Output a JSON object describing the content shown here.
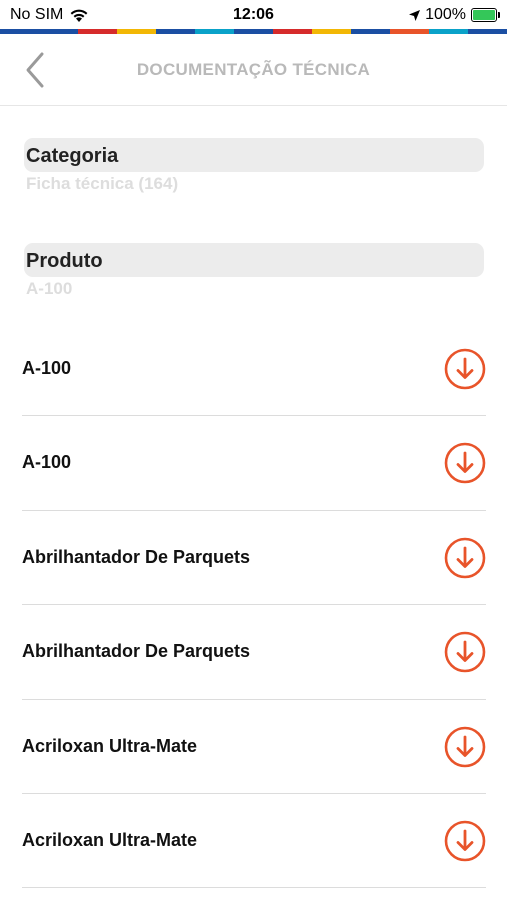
{
  "status_bar": {
    "carrier": "No SIM",
    "time": "12:06",
    "battery": "100%"
  },
  "colors": {
    "accent": "#e8542a",
    "title_gray": "#b9b9b9",
    "strip": [
      "#1b4fa3",
      "#1b4fa3",
      "#d62b2b",
      "#f2b705",
      "#1b4fa3",
      "#0aa2c9",
      "#1b4fa3",
      "#d62b2b",
      "#f2b705",
      "#1b4fa3",
      "#e8542a",
      "#0aa2c9",
      "#1b4fa3"
    ]
  },
  "header": {
    "title": "DOCUMENTAÇÃO TÉCNICA",
    "back_icon": "chevron-left-icon"
  },
  "filters": {
    "categoria": {
      "label": "Categoria",
      "value": "Ficha técnica (164)"
    },
    "produto": {
      "label": "Produto",
      "value": "A-100"
    }
  },
  "documents": [
    {
      "name": "A-100",
      "icon": "download-icon"
    },
    {
      "name": "A-100",
      "icon": "download-icon"
    },
    {
      "name": "Abrilhantador De Parquets",
      "icon": "download-icon"
    },
    {
      "name": "Abrilhantador De Parquets",
      "icon": "download-icon"
    },
    {
      "name": "Acriloxan Ultra-Mate",
      "icon": "download-icon"
    },
    {
      "name": "Acriloxan Ultra-Mate",
      "icon": "download-icon"
    }
  ]
}
